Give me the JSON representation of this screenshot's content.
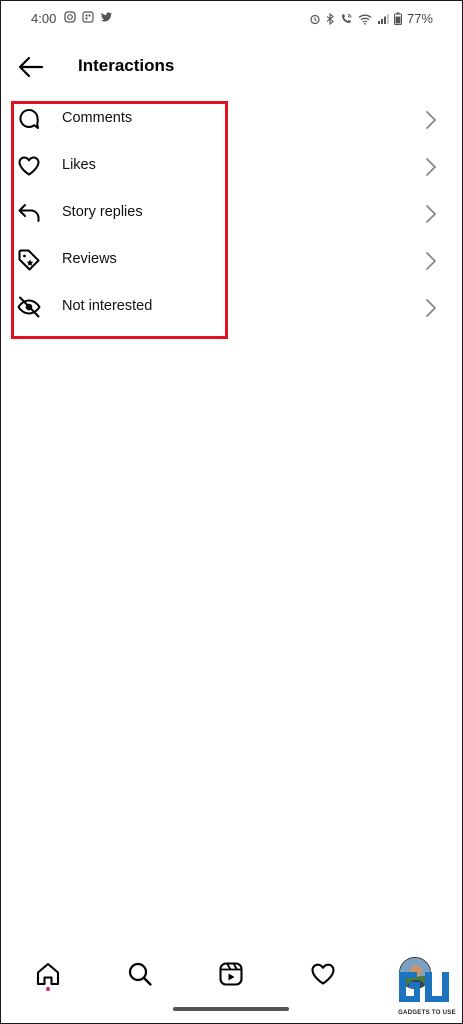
{
  "status_bar": {
    "time": "4:00",
    "battery": "77%",
    "left_icons": [
      "instagram-icon",
      "grid-icon",
      "twitter-icon"
    ],
    "right_icons": [
      "alarm-icon",
      "bluetooth-icon",
      "wifi-call-icon",
      "wifi-icon",
      "signal-icon",
      "battery-icon"
    ]
  },
  "header": {
    "title": "Interactions",
    "back_icon": "arrow-left-icon"
  },
  "menu": {
    "items": [
      {
        "label": "Comments",
        "icon": "comment-bubble-icon"
      },
      {
        "label": "Likes",
        "icon": "heart-icon"
      },
      {
        "label": "Story replies",
        "icon": "reply-arrow-icon"
      },
      {
        "label": "Reviews",
        "icon": "tag-icon"
      },
      {
        "label": "Not interested",
        "icon": "eye-off-icon"
      }
    ],
    "highlight_color": "#e0121b"
  },
  "bottom_nav": {
    "items": [
      "home-icon",
      "search-icon",
      "reels-icon",
      "heart-icon",
      "avatar"
    ],
    "notification_dot_color": "#e0245e"
  },
  "watermark": {
    "text": "GADGETS TO USE",
    "logo_color": "#1e73be"
  }
}
